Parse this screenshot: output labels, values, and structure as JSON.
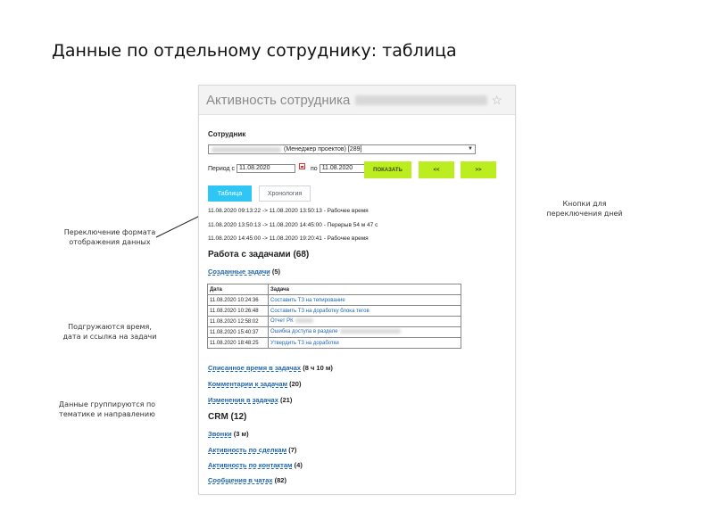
{
  "slide_title": "Данные по отдельному сотруднику: таблица",
  "notes": {
    "tabs_note": [
      "Переключение формата",
      "отображения данных"
    ],
    "load_note": [
      "Подгружаются время,",
      "дата и ссылка на задачи"
    ],
    "group_note": [
      "Данные группируются по",
      "тематике и направлению"
    ],
    "days_note": [
      "Кнопки для",
      "переключения дней"
    ]
  },
  "panel": {
    "title": "Активность сотрудника",
    "employee_label": "Сотрудник",
    "employee_select_value": "(Менеджер проектов) [289]",
    "period_from_label": "Период с",
    "date_from": "11.08.2020",
    "period_to_label": "по",
    "date_to": "11.08.2020",
    "show_button": "ПОКАЗАТЬ",
    "prev_button": "<<",
    "next_button": ">>",
    "tabs": {
      "table": "Таблица",
      "history": "Хронология"
    },
    "log": [
      "11.08.2020 09:13:22 -> 11.08.2020 13:50:13 - Рабочее время",
      "11.08.2020 13:50:13 -> 11.08.2020 14:45:00 - Перерыв 54 м 47 с",
      "11.08.2020 14:45:00 -> 11.08.2020 19:20:41 - Рабочее время"
    ],
    "work_heading": "Работа с задачами (68)",
    "created_tasks": {
      "label": "Созданные задачи",
      "count": "(5)"
    },
    "table": {
      "headers": [
        "Дата",
        "Задача"
      ],
      "rows": [
        {
          "date": "11.08.2020 10:24:36",
          "task": "Составить ТЗ на тепирование"
        },
        {
          "date": "11.08.2020 10:26:48",
          "task": "Составить ТЗ на доработку блока тегов"
        },
        {
          "date": "11.08.2020 12:58:02",
          "task": "Отчет РК"
        },
        {
          "date": "11.08.2020 15:40:37",
          "task": "Ошибка доступа в разделе"
        },
        {
          "date": "11.08.2020 18:48:25",
          "task": "Утвердить ТЗ на доработки"
        }
      ]
    },
    "spent_time": {
      "label": "Списанное время в задачах",
      "count": "(8 ч 10 м)"
    },
    "comments": {
      "label": "Комментарии к задачам",
      "count": "(20)"
    },
    "changes": {
      "label": "Изменения в задачах",
      "count": "(21)"
    },
    "crm_heading": "CRM (12)",
    "calls": {
      "label": "Звонки",
      "count": "(3 м)"
    },
    "deals": {
      "label": "Активность по сделкам",
      "count": "(7)"
    },
    "contacts": {
      "label": "Активность по контактам",
      "count": "(4)"
    },
    "chats": {
      "label": "Сообщения в чатах",
      "count": "(82)"
    }
  },
  "colors": {
    "accent_green": "#bbed21",
    "tab_active": "#2fc6f6",
    "link": "#2067b0"
  }
}
